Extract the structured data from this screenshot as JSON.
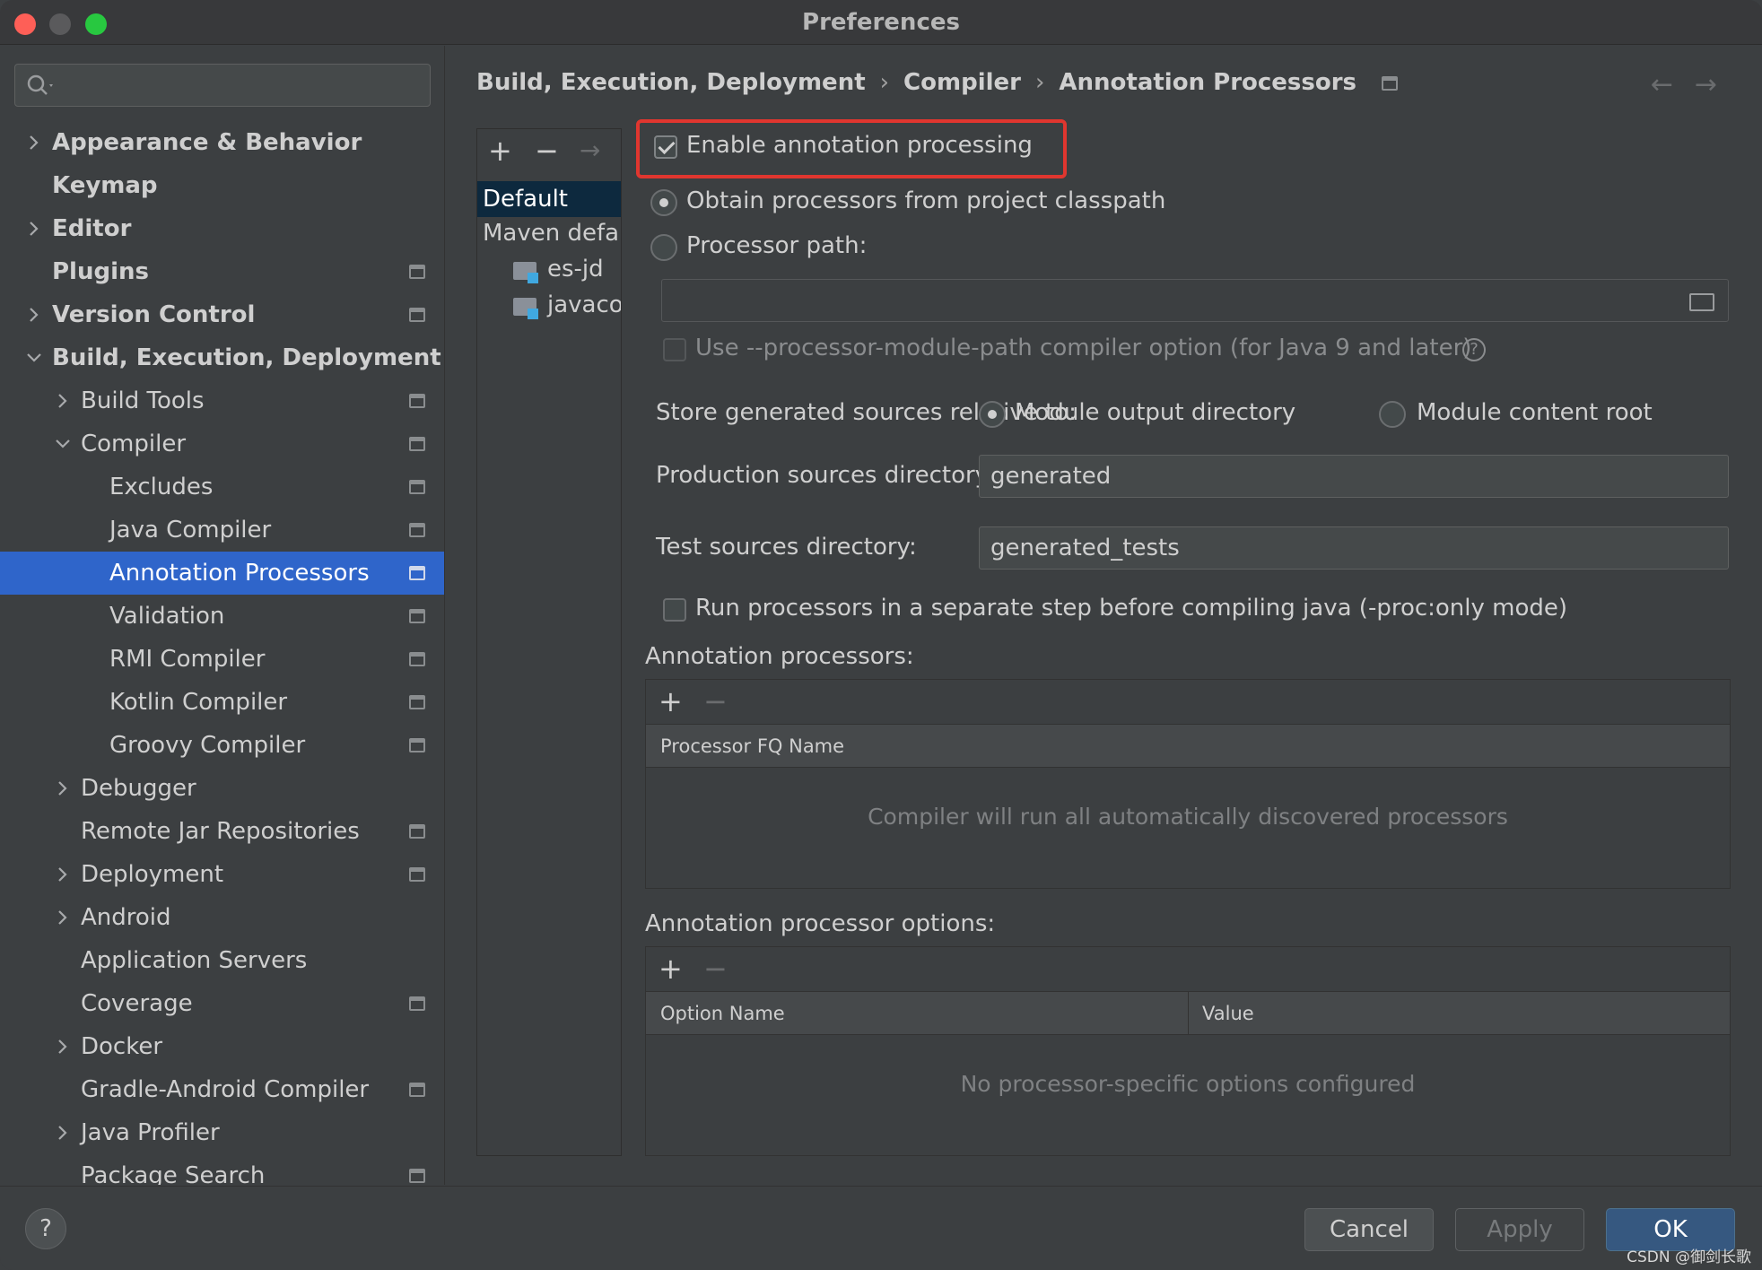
{
  "window": {
    "title": "Preferences"
  },
  "sidebar": {
    "search_placeholder": "",
    "items": [
      {
        "label": "Appearance & Behavior",
        "level": 0,
        "chevron": "right",
        "bold": true,
        "project_icon": false
      },
      {
        "label": "Keymap",
        "level": 0,
        "chevron": "none",
        "bold": true,
        "project_icon": false
      },
      {
        "label": "Editor",
        "level": 0,
        "chevron": "right",
        "bold": true,
        "project_icon": false
      },
      {
        "label": "Plugins",
        "level": 0,
        "chevron": "none",
        "bold": true,
        "project_icon": true
      },
      {
        "label": "Version Control",
        "level": 0,
        "chevron": "right",
        "bold": true,
        "project_icon": true
      },
      {
        "label": "Build, Execution, Deployment",
        "level": 0,
        "chevron": "down",
        "bold": true,
        "project_icon": false
      },
      {
        "label": "Build Tools",
        "level": 1,
        "chevron": "right",
        "bold": false,
        "project_icon": true
      },
      {
        "label": "Compiler",
        "level": 1,
        "chevron": "down",
        "bold": false,
        "project_icon": true
      },
      {
        "label": "Excludes",
        "level": 2,
        "chevron": "none",
        "bold": false,
        "project_icon": true
      },
      {
        "label": "Java Compiler",
        "level": 2,
        "chevron": "none",
        "bold": false,
        "project_icon": true
      },
      {
        "label": "Annotation Processors",
        "level": 2,
        "chevron": "none",
        "bold": false,
        "project_icon": true,
        "selected": true
      },
      {
        "label": "Validation",
        "level": 2,
        "chevron": "none",
        "bold": false,
        "project_icon": true
      },
      {
        "label": "RMI Compiler",
        "level": 2,
        "chevron": "none",
        "bold": false,
        "project_icon": true
      },
      {
        "label": "Kotlin Compiler",
        "level": 2,
        "chevron": "none",
        "bold": false,
        "project_icon": true
      },
      {
        "label": "Groovy Compiler",
        "level": 2,
        "chevron": "none",
        "bold": false,
        "project_icon": true
      },
      {
        "label": "Debugger",
        "level": 1,
        "chevron": "right",
        "bold": false,
        "project_icon": false
      },
      {
        "label": "Remote Jar Repositories",
        "level": 1,
        "chevron": "none",
        "bold": false,
        "project_icon": true
      },
      {
        "label": "Deployment",
        "level": 1,
        "chevron": "right",
        "bold": false,
        "project_icon": true
      },
      {
        "label": "Android",
        "level": 1,
        "chevron": "right",
        "bold": false,
        "project_icon": false
      },
      {
        "label": "Application Servers",
        "level": 1,
        "chevron": "none",
        "bold": false,
        "project_icon": false
      },
      {
        "label": "Coverage",
        "level": 1,
        "chevron": "none",
        "bold": false,
        "project_icon": true
      },
      {
        "label": "Docker",
        "level": 1,
        "chevron": "right",
        "bold": false,
        "project_icon": false
      },
      {
        "label": "Gradle-Android Compiler",
        "level": 1,
        "chevron": "none",
        "bold": false,
        "project_icon": true
      },
      {
        "label": "Java Profiler",
        "level": 1,
        "chevron": "right",
        "bold": false,
        "project_icon": false
      },
      {
        "label": "Package Search",
        "level": 1,
        "chevron": "none",
        "bold": false,
        "project_icon": true
      }
    ]
  },
  "breadcrumb": {
    "items": [
      "Build, Execution, Deployment",
      "Compiler",
      "Annotation Processors"
    ],
    "separator": "›",
    "back_icon": "←",
    "forward_icon": "→"
  },
  "profiles": {
    "add_icon": "+",
    "remove_icon": "−",
    "move_icon": "→",
    "items": [
      {
        "label": "Default",
        "selected": true,
        "indent": 0,
        "folder": false
      },
      {
        "label": "Maven defau",
        "selected": false,
        "indent": 0,
        "folder": false
      },
      {
        "label": "es-jd",
        "selected": false,
        "indent": 1,
        "folder": true
      },
      {
        "label": "javacod",
        "selected": false,
        "indent": 1,
        "folder": true
      }
    ]
  },
  "settings": {
    "enable_processing": {
      "label": "Enable annotation processing",
      "checked": true
    },
    "obtain_from_classpath": {
      "label": "Obtain processors from project classpath",
      "selected": true
    },
    "processor_path": {
      "label": "Processor path:",
      "selected": false,
      "value": ""
    },
    "module_path_option": {
      "label": "Use --processor-module-path compiler option (for Java 9 and later)",
      "checked": false,
      "help": "?"
    },
    "store_relative": {
      "label": "Store generated sources relative to:",
      "options": [
        {
          "label": "Module output directory",
          "selected": true
        },
        {
          "label": "Module content root",
          "selected": false
        }
      ]
    },
    "production_dir": {
      "label": "Production sources directory:",
      "value": "generated"
    },
    "test_dir": {
      "label": "Test sources directory:",
      "value": "generated_tests"
    },
    "separate_step": {
      "label": "Run processors in a separate step before compiling java (-proc:only mode)",
      "checked": false
    },
    "processors_table": {
      "title": "Annotation processors:",
      "add_icon": "+",
      "remove_icon": "−",
      "columns": [
        "Processor FQ Name"
      ],
      "empty_text": "Compiler will run all automatically discovered processors"
    },
    "options_table": {
      "title": "Annotation processor options:",
      "add_icon": "+",
      "remove_icon": "−",
      "columns": [
        "Option Name",
        "Value"
      ],
      "empty_text": "No processor-specific options configured"
    }
  },
  "footer": {
    "help_label": "?",
    "cancel_label": "Cancel",
    "apply_label": "Apply",
    "ok_label": "OK",
    "watermark": "CSDN @御剑长歌"
  },
  "colors": {
    "accent_selection": "#2f65ca",
    "highlight_box": "#e0362f",
    "primary_button": "#365880"
  }
}
